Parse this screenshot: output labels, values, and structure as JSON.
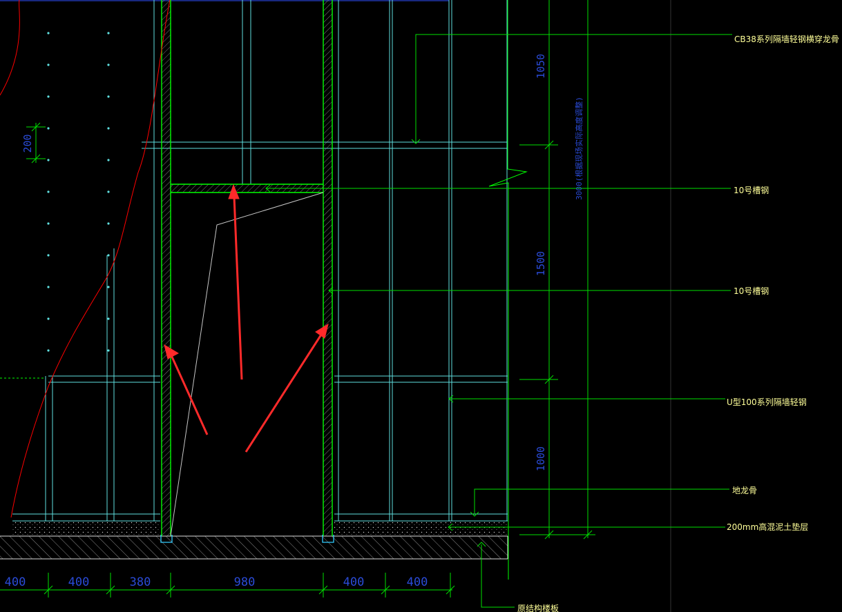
{
  "drawing": {
    "labels": {
      "cb38": "CB38系列隔墙轻钢横穿龙骨",
      "channel_upper": "10号槽钢",
      "channel_mid": "10号槽钢",
      "u100": "U型100系列隔墙轻钢",
      "floor_keel": "地龙骨",
      "concrete_pad": "200mm高混泥土垫层",
      "slab": "原结构楼板"
    },
    "dimensions": {
      "bottom": [
        "400",
        "400",
        "380",
        "980",
        "400",
        "400"
      ],
      "left_vertical": "200",
      "right_v1": "1050",
      "right_v2": "1500",
      "right_v3": "1000",
      "total_height": "3000(根据现场实际高度调整)"
    },
    "colors": {
      "background": "#000000",
      "steel_green": "#00ff00",
      "keel_cyan": "#5fe0e0",
      "leader_green": "#00e000",
      "dimension_blue": "#2a4bd7",
      "label_yellow": "#ffff99",
      "hatch_grey": "#c8c8c8",
      "annotation_red": "#ff2a2a",
      "contour_red": "#ff0000"
    }
  }
}
